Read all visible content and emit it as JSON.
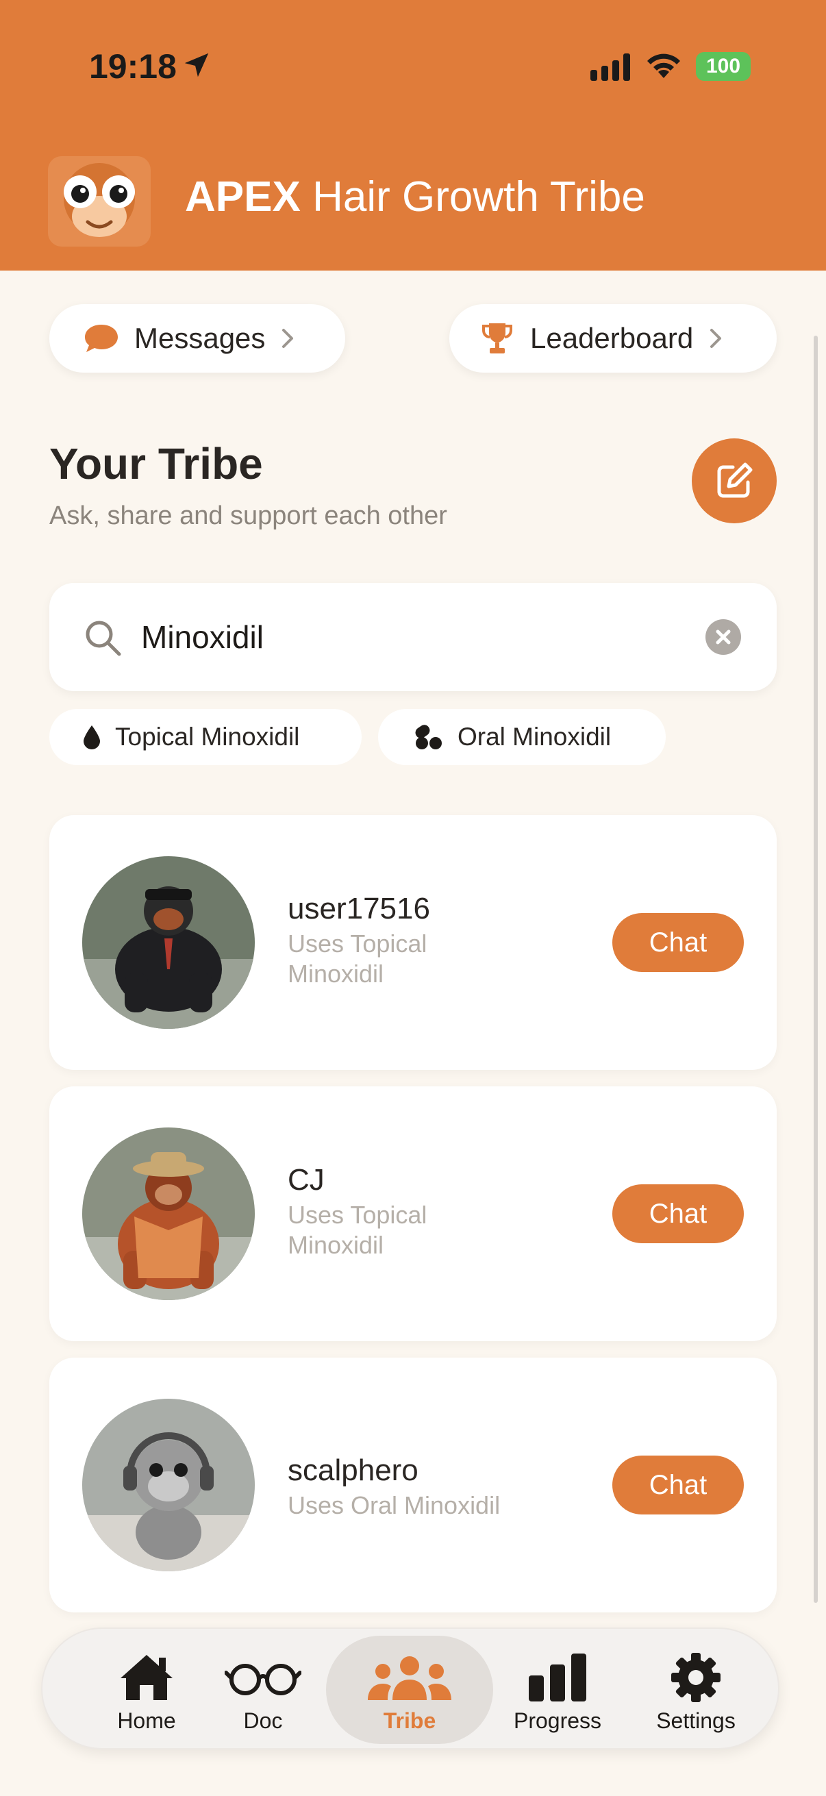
{
  "status_bar": {
    "time": "19:18",
    "battery": "100"
  },
  "header": {
    "title_strong": "APEX",
    "title_rest": "Hair Growth Tribe"
  },
  "quick_links": {
    "messages": "Messages",
    "leaderboard": "Leaderboard"
  },
  "section": {
    "title": "Your Tribe",
    "subtitle": "Ask, share and support each other"
  },
  "search": {
    "value": "Minoxidil"
  },
  "filters": [
    {
      "label": "Topical Minoxidil",
      "icon": "drop-icon"
    },
    {
      "label": "Oral Minoxidil",
      "icon": "pills-icon"
    }
  ],
  "users": [
    {
      "name": "user17516",
      "subtitle": "Uses Topical Minoxidil",
      "chat": "Chat"
    },
    {
      "name": "CJ",
      "subtitle": "Uses Topical Minoxidil",
      "chat": "Chat"
    },
    {
      "name": "scalphero",
      "subtitle": "Uses Oral Minoxidil",
      "chat": "Chat"
    }
  ],
  "tabs": [
    {
      "label": "Home",
      "icon": "house-icon"
    },
    {
      "label": "Doc",
      "icon": "glasses-icon"
    },
    {
      "label": "Tribe",
      "icon": "group-icon",
      "active": true
    },
    {
      "label": "Progress",
      "icon": "bar-chart-icon"
    },
    {
      "label": "Settings",
      "icon": "gear-icon"
    }
  ],
  "colors": {
    "accent": "#E07C3A",
    "background": "#FBF6EF",
    "battery": "#5DC25A"
  }
}
